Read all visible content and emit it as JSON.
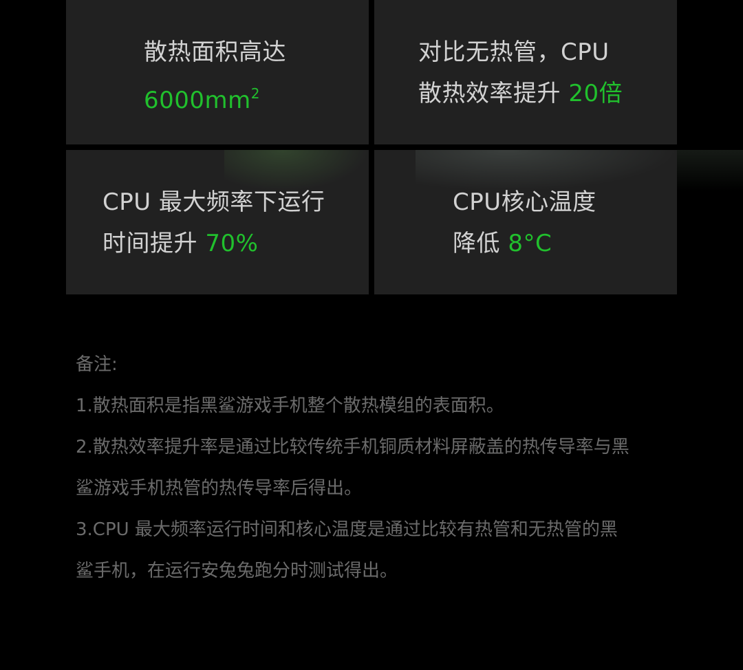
{
  "cards": [
    {
      "line1": "散热面积高达",
      "line2_prefix": "",
      "line2_highlight": "6000mm",
      "line2_sup": "2"
    },
    {
      "line1": "对比无热管，CPU",
      "line2_prefix": "散热效率提升 ",
      "line2_highlight": "20倍"
    },
    {
      "line1": "CPU 最大频率下运行",
      "line2_prefix": "时间提升 ",
      "line2_highlight": "70%"
    },
    {
      "line1": "CPU核心温度",
      "line2_prefix": "降低 ",
      "line2_highlight": "8°C"
    }
  ],
  "notes": {
    "heading": "备注:",
    "item1": "1.散热面积是指黑鲨游戏手机整个散热模组的表面积。",
    "item2_line1": "2.散热效率提升率是通过比较传统手机铜质材料屏蔽盖的热传导率与黑",
    "item2_line2": "鲨游戏手机热管的热传导率后得出。",
    "item3_line1": "3.CPU 最大频率运行时间和核心温度是通过比较有热管和无热管的黑",
    "item3_line2": "鲨手机，在运行安兔兔跑分时测试得出。"
  },
  "colors": {
    "background": "#000000",
    "card": "#212121",
    "text": "#d2d2d2",
    "accent": "#21c02d",
    "note_text": "#6b6b6b"
  }
}
